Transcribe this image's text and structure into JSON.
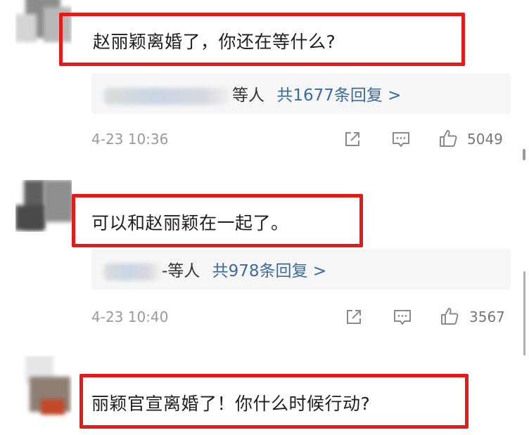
{
  "comments": [
    {
      "text": "赵丽颖离婚了，你还在等什么?",
      "replies": {
        "names_suffix": "等人",
        "count_label": "共1677条回复 >"
      },
      "timestamp": "4-23 10:36",
      "likes": "5049"
    },
    {
      "text": "可以和赵丽颖在一起了。",
      "replies": {
        "names_suffix": "-等人",
        "count_label": "共978条回复 >"
      },
      "timestamp": "4-23 10:40",
      "likes": "3567"
    },
    {
      "text": "丽颖官宣离婚了！你什么时候行动?"
    }
  ],
  "colors": {
    "highlight": "#e31b1b",
    "reply_link": "#3b6a9c",
    "muted": "#9a9a9a"
  },
  "icons": [
    "share-icon",
    "comment-icon",
    "like-icon"
  ]
}
